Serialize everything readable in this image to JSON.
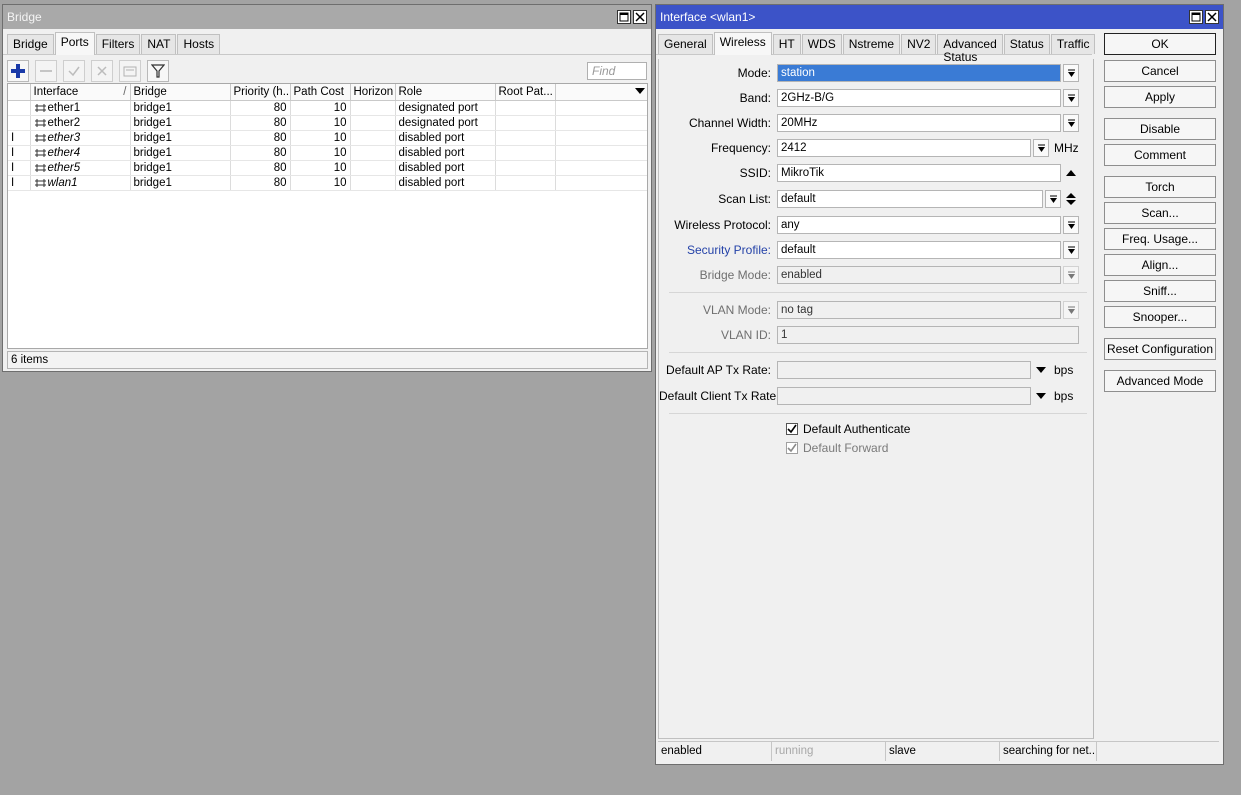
{
  "bridge_window": {
    "title": "Bridge",
    "tabs": [
      "Bridge",
      "Ports",
      "Filters",
      "NAT",
      "Hosts"
    ],
    "active_tab": "Ports",
    "find_placeholder": "Find",
    "columns": [
      "Interface",
      "Bridge",
      "Priority (h...",
      "Path Cost",
      "Horizon",
      "Role",
      "Root Pat..."
    ],
    "sort_indicator": "/",
    "rows": [
      {
        "flag": "",
        "interface": "ether1",
        "bridge": "bridge1",
        "priority": "80",
        "path_cost": "10",
        "horizon": "",
        "role": "designated port",
        "root_path": ""
      },
      {
        "flag": "",
        "interface": "ether2",
        "bridge": "bridge1",
        "priority": "80",
        "path_cost": "10",
        "horizon": "",
        "role": "designated port",
        "root_path": ""
      },
      {
        "flag": "I",
        "interface": "ether3",
        "bridge": "bridge1",
        "priority": "80",
        "path_cost": "10",
        "horizon": "",
        "role": "disabled port",
        "root_path": ""
      },
      {
        "flag": "I",
        "interface": "ether4",
        "bridge": "bridge1",
        "priority": "80",
        "path_cost": "10",
        "horizon": "",
        "role": "disabled port",
        "root_path": ""
      },
      {
        "flag": "I",
        "interface": "ether5",
        "bridge": "bridge1",
        "priority": "80",
        "path_cost": "10",
        "horizon": "",
        "role": "disabled port",
        "root_path": ""
      },
      {
        "flag": "I",
        "interface": "wlan1",
        "bridge": "bridge1",
        "priority": "80",
        "path_cost": "10",
        "horizon": "",
        "role": "disabled port",
        "root_path": ""
      }
    ],
    "status": "6 items"
  },
  "iface_window": {
    "title": "Interface <wlan1>",
    "tabs": [
      "General",
      "Wireless",
      "HT",
      "WDS",
      "Nstreme",
      "NV2",
      "Advanced Status",
      "Status",
      "Traffic"
    ],
    "active_tab": "Wireless",
    "fields": {
      "mode": {
        "label": "Mode:",
        "value": "station"
      },
      "band": {
        "label": "Band:",
        "value": "2GHz-B/G"
      },
      "channel_width": {
        "label": "Channel Width:",
        "value": "20MHz"
      },
      "frequency": {
        "label": "Frequency:",
        "value": "2412",
        "unit": "MHz"
      },
      "ssid": {
        "label": "SSID:",
        "value": "MikroTik"
      },
      "scan_list": {
        "label": "Scan List:",
        "value": "default"
      },
      "wireless_protocol": {
        "label": "Wireless Protocol:",
        "value": "any"
      },
      "security_profile": {
        "label": "Security Profile:",
        "value": "default"
      },
      "bridge_mode": {
        "label": "Bridge Mode:",
        "value": "enabled"
      },
      "vlan_mode": {
        "label": "VLAN Mode:",
        "value": "no tag"
      },
      "vlan_id": {
        "label": "VLAN ID:",
        "value": "1"
      },
      "default_ap_tx_rate": {
        "label": "Default AP Tx Rate:",
        "value": "",
        "unit": "bps"
      },
      "default_client_tx_rate": {
        "label": "Default Client Tx Rate:",
        "value": "",
        "unit": "bps"
      }
    },
    "checkboxes": {
      "default_authenticate": {
        "label": "Default Authenticate",
        "checked": true
      },
      "default_forward": {
        "label": "Default Forward",
        "checked": true
      }
    },
    "buttons": [
      "OK",
      "Cancel",
      "Apply",
      "Disable",
      "Comment",
      "Torch",
      "Scan...",
      "Freq. Usage...",
      "Align...",
      "Sniff...",
      "Snooper...",
      "Reset Configuration",
      "Advanced Mode"
    ],
    "status_segments": [
      "enabled",
      "running",
      "slave",
      "searching for net..."
    ]
  },
  "colors": {
    "active_title": "#3c53c8",
    "inactive_title": "#a9a9a9",
    "desktop": "#a3a3a3",
    "link_label": "#2442a8",
    "selection": "#3a7bd5"
  }
}
